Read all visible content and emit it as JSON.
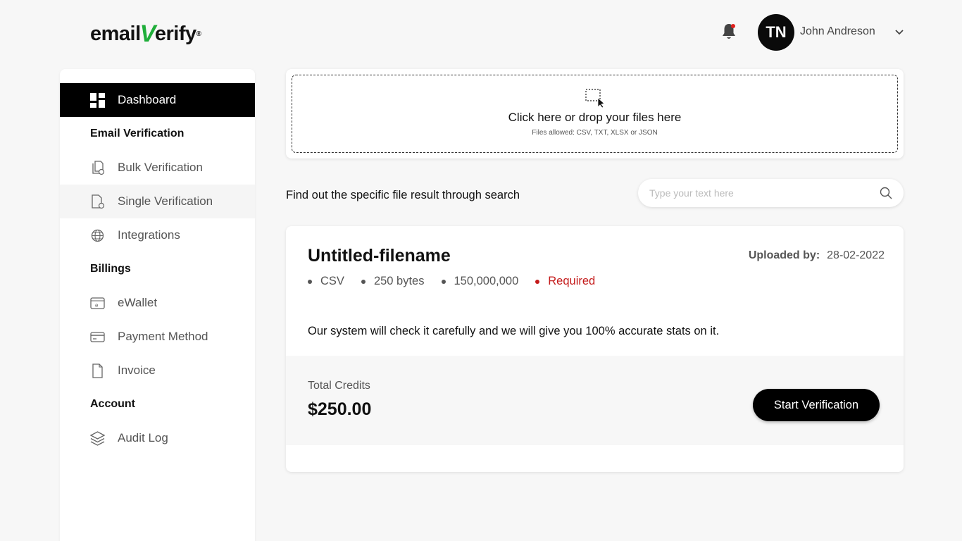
{
  "brand": {
    "logo_pre": "email",
    "logo_v": "V",
    "logo_post": "erify",
    "logo_reg": "®"
  },
  "header": {
    "avatar_initials": "TN",
    "username": "John Andreson",
    "notification_color": "#e0201d"
  },
  "sidebar": {
    "active": {
      "label": "Dashboard",
      "icon": "dashboard-icon"
    },
    "sections": [
      {
        "heading": "Email Verification",
        "items": [
          {
            "label": "Bulk Verification",
            "icon": "bulk-files-icon"
          },
          {
            "label": "Single Verification",
            "icon": "single-file-icon"
          },
          {
            "label": "Integrations",
            "icon": "globe-icon"
          }
        ]
      },
      {
        "heading": "Billings",
        "items": [
          {
            "label": "eWallet",
            "icon": "wallet-icon"
          },
          {
            "label": "Payment Method",
            "icon": "credit-card-icon"
          },
          {
            "label": "Invoice",
            "icon": "document-icon"
          }
        ]
      },
      {
        "heading": "Account",
        "items": [
          {
            "label": "Audit Log",
            "icon": "layers-icon"
          }
        ]
      }
    ]
  },
  "upload": {
    "title": "Click here or drop your files here",
    "subtitle": "Files allowed: CSV, TXT, XLSX or JSON"
  },
  "search": {
    "prompt": "Find out the specific file result through search",
    "placeholder": "Type your text here"
  },
  "file": {
    "name": "Untitled-filename",
    "uploaded_label": "Uploaded by:",
    "uploaded_date": "28-02-2022",
    "meta": [
      "CSV",
      "250 bytes",
      "150,000,000"
    ],
    "status": "Required",
    "status_color": "#c41a1a",
    "description": "Our system will check it carefully and we will give you 100% accurate stats on it.",
    "credits_label": "Total Credits",
    "credits_value": "$250.00",
    "start_button": "Start Verification"
  }
}
